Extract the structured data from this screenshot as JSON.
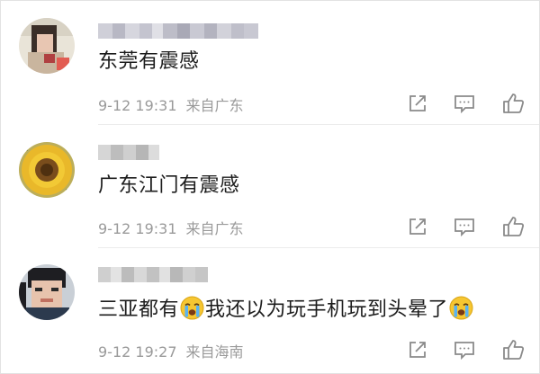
{
  "comments": [
    {
      "text": "东莞有震感",
      "time": "9-12 19:31",
      "location": "来自广东"
    },
    {
      "text": "广东江门有震感",
      "time": "9-12 19:31",
      "location": "来自广东"
    },
    {
      "text_before": "三亚都有",
      "text_after": "我还以为玩手机玩到头晕了",
      "time": "9-12 19:27",
      "location": "来自海南",
      "emoji": "crying-face-emoji"
    }
  ],
  "icons": {
    "share": "share-icon",
    "comment": "comment-icon",
    "like": "thumbs-up-icon"
  },
  "colors": {
    "text": "#1c1c1c",
    "meta": "#9a9a9a",
    "icon": "#8a8a8a",
    "divider": "#ececec"
  }
}
